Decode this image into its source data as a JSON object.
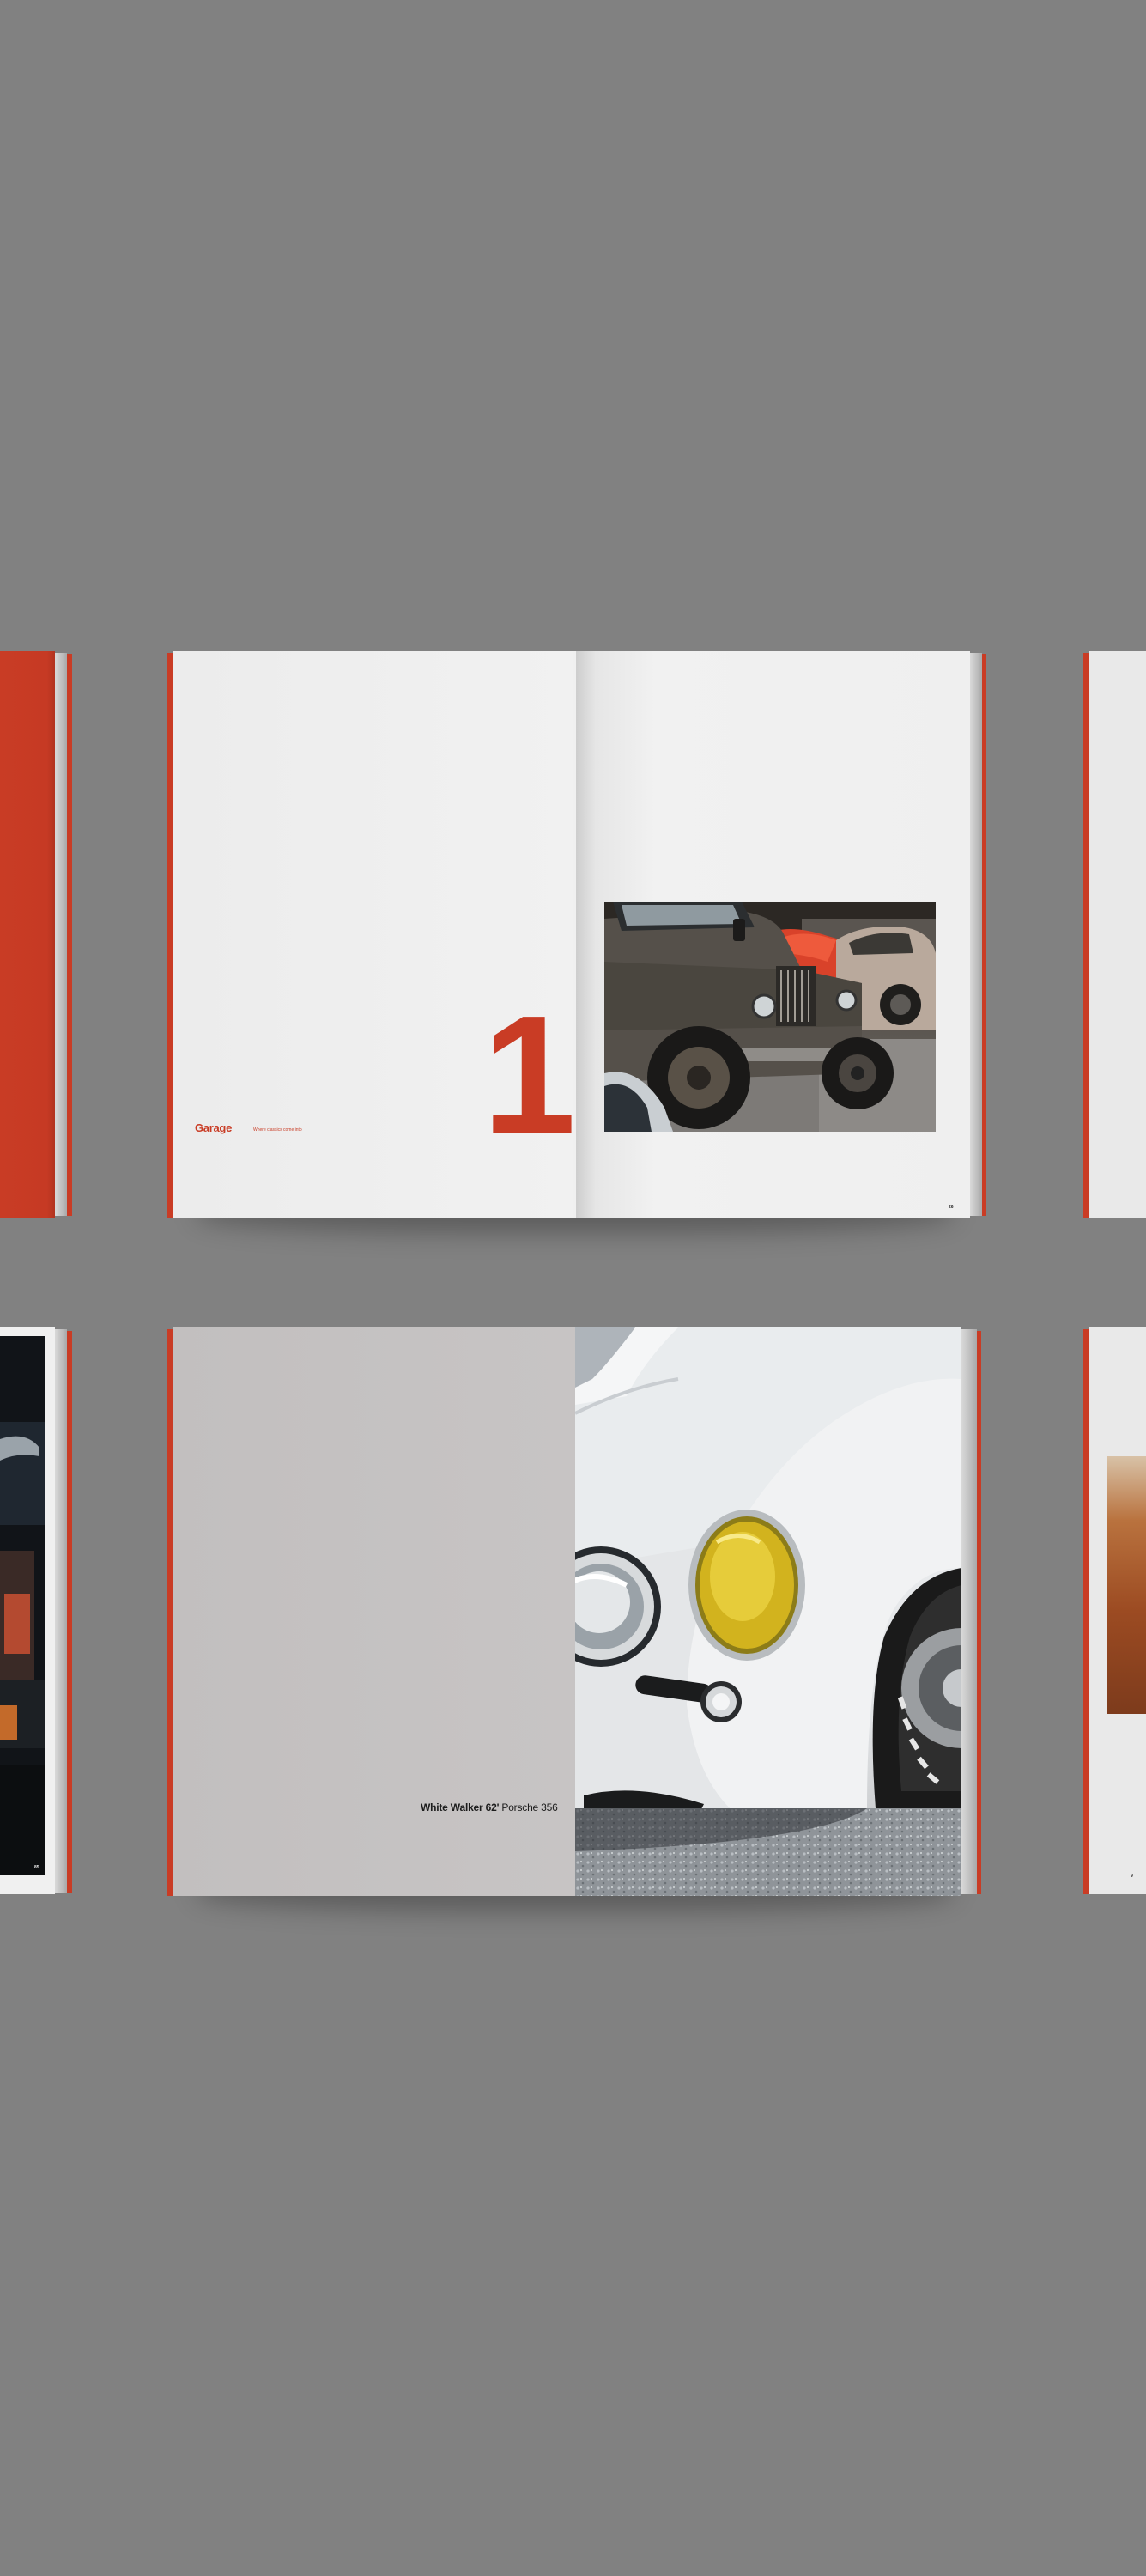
{
  "spread_top": {
    "chapter_number": "1",
    "title": "Garage",
    "subtitle": "Where classics come into",
    "page_number": "26"
  },
  "spread_bottom": {
    "caption_bold": "White Walker 62'",
    "caption_regular": "Porsche 356"
  },
  "partial_left_bottom": {
    "page_number": "85"
  },
  "partial_right_bottom": {
    "page_number": "9"
  },
  "colors": {
    "background": "#818181",
    "accent_red": "#c93c25",
    "page_light": "#efefef",
    "page_grey": "#c4c1c1"
  }
}
